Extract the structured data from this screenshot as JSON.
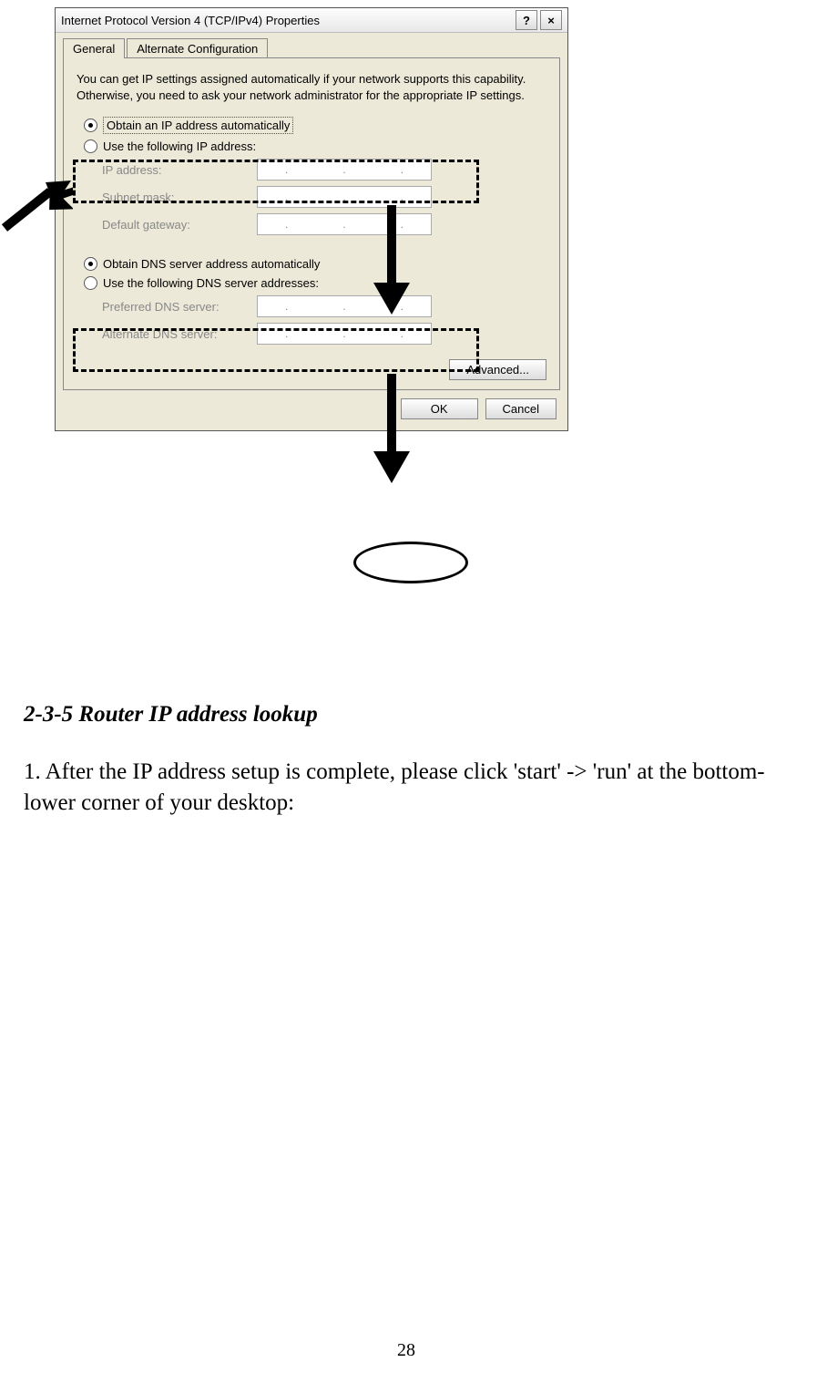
{
  "dialog": {
    "title": "Internet Protocol Version 4 (TCP/IPv4) Properties",
    "help": "?",
    "close": "×",
    "tabs": {
      "general": "General",
      "alternate": "Alternate Configuration"
    },
    "description": "You can get IP settings assigned automatically if your network supports this capability. Otherwise, you need to ask your network administrator for the appropriate IP settings.",
    "ip": {
      "auto": "Obtain an IP address automatically",
      "manual": "Use the following IP address:",
      "ip_label": "IP address:",
      "subnet_label": "Subnet mask:",
      "gateway_label": "Default gateway:"
    },
    "dns": {
      "auto": "Obtain DNS server address automatically",
      "manual": "Use the following DNS server addresses:",
      "preferred_label": "Preferred DNS server:",
      "alternate_label": "Alternate DNS server:"
    },
    "advanced": "Advanced...",
    "ok": "OK",
    "cancel": "Cancel"
  },
  "doc": {
    "heading": "2-3-5 Router IP address lookup",
    "body": "1. After the IP address setup is complete, please click 'start' -> 'run' at the bottom-lower corner of your desktop:",
    "page_number": "28"
  }
}
